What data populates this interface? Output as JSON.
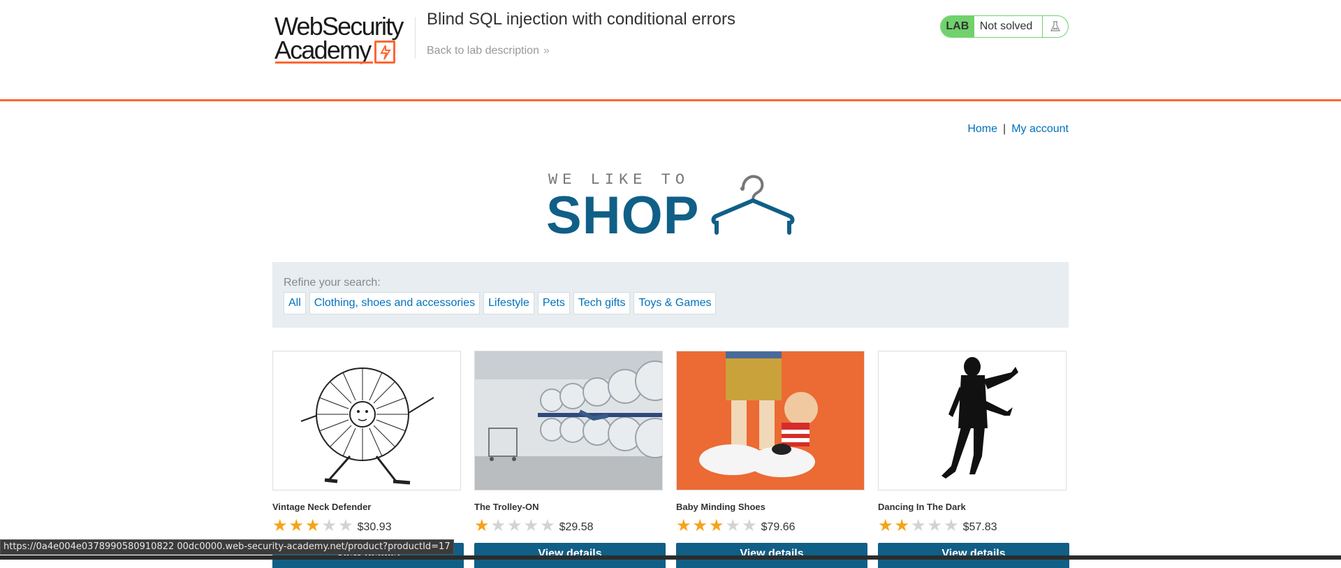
{
  "header": {
    "logo_line1": "WebSecurity",
    "logo_line2": "Academy",
    "lab_title": "Blind SQL injection with conditional errors",
    "back_link": "Back to lab description",
    "back_chevron": "»",
    "lab_badge": "LAB",
    "lab_state": "Not solved",
    "flask_icon": "flask-icon",
    "accent_color": "#ff6633",
    "status_color": "#70d16d"
  },
  "nav": {
    "home": "Home",
    "separator": "|",
    "my_account": "My account"
  },
  "hero": {
    "tagline": "WE LIKE TO",
    "shop": "SHOP",
    "icon": "hanger-icon"
  },
  "filters": {
    "label": "Refine your search:",
    "categories": [
      "All",
      "Clothing, shoes and accessories",
      "Lifestyle",
      "Pets",
      "Tech gifts",
      "Toys & Games"
    ]
  },
  "products": [
    {
      "name": "Vintage Neck Defender",
      "rating": 3,
      "price": "$30.93",
      "button": "View details"
    },
    {
      "name": "The Trolley-ON",
      "rating": 1,
      "price": "$29.58",
      "button": "View details"
    },
    {
      "name": "Baby Minding Shoes",
      "rating": 3,
      "price": "$79.66",
      "button": "View details"
    },
    {
      "name": "Dancing In The Dark",
      "rating": 2,
      "price": "$57.83",
      "button": "View details"
    }
  ],
  "status_bar": {
    "url": "https://0a4e004e0378990580910822 00dc0000.web-security-academy.net/product?productId=17"
  },
  "brand_color": "#105f87",
  "link_color": "#0071bc"
}
